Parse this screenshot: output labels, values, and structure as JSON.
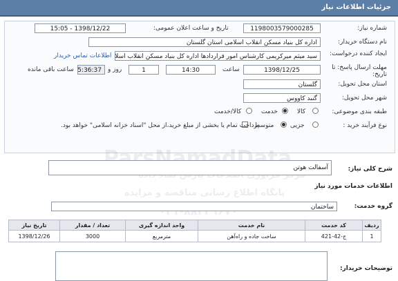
{
  "header": {
    "title": "جزئیات اطلاعات نیاز"
  },
  "form": {
    "need_number_label": "شماره نیاز:",
    "need_number": "1198003579000285",
    "announce_label": "تاریخ و ساعت اعلان عمومی:",
    "announce_value": "1398/12/22 - 15:05",
    "buyer_label": "نام دستگاه خریدار:",
    "buyer_value": "اداره کل بنیاد مسکن انقلاب اسلامی استان گلستان",
    "creator_label": "ایجاد کننده درخواست:",
    "creator_value": "سید میثم میرکریمی کارشناس امور قراردادها اداره کل بنیاد مسکن انقلاب اسلا",
    "contact_link": "اطلاعات تماس خریدار",
    "deadline_label": "مهلت ارسال پاسخ: تا تاریخ:",
    "deadline_date": "1398/12/25",
    "time_label": "ساعت",
    "deadline_time": "14:30",
    "days_value": "1",
    "days_label": "روز و",
    "remaining_time": "05:36:37",
    "remaining_label": "ساعت باقی مانده",
    "province_label": "استان محل تحویل:",
    "province_value": "گلستان",
    "city_label": "شهر محل تحویل:",
    "city_value": "گنبد کاووس",
    "category_label": "طبقه بندی موضوعی:",
    "category_options": [
      "کالا",
      "خدمت",
      "کالا/خدمت"
    ],
    "category_selected": "خدمت",
    "process_label": "نوع فرآیند خرید :",
    "process_options": [
      "جزیی",
      "متوسط"
    ],
    "process_selected": "متوسط",
    "payment_text": "پرداخت تمام یا بخشی از مبلغ خرید،از محل \"اسناد خزانه اسلامی\" خواهد بود."
  },
  "summary": {
    "label": "شرح کلی نیاز:",
    "value": "آسفالت هوتن"
  },
  "services": {
    "section_title": "اطلاعات خدمات مورد نیاز",
    "group_label": "گروه خدمت:",
    "group_value": "ساختمان",
    "columns": [
      "ردیف",
      "کد خدمت",
      "نام خدمت",
      "واحد اندازه گیری",
      "تعداد / مقدار",
      "تاریخ نیاز"
    ],
    "rows": [
      {
        "row": "1",
        "code": "ج-42-421",
        "name": "ساخت جاده و راه‌آهن",
        "unit": "مترمربع",
        "qty": "3000",
        "date": "1398/12/26"
      }
    ]
  },
  "buyer_notes": {
    "label": "توضیحات خریدار:"
  },
  "watermark": {
    "line1": "ParsNamadData",
    "line2": "مرکز فرآوری اطلاعات پارس نماد داده",
    "line3": "پایگاه اطلاع رسانی مناقصه و مزایده",
    "line4": "۰۲۱-۸۸۳۴۹۶۷۰"
  },
  "colors": {
    "header": "#5b7fa6",
    "link": "#2a62b8",
    "time_bg": "#e9ecf0"
  }
}
